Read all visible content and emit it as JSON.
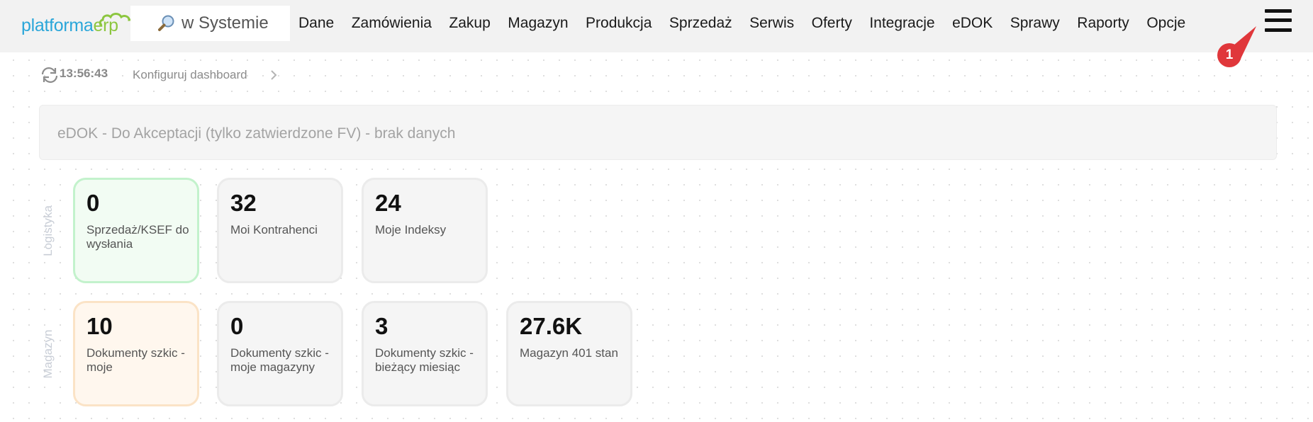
{
  "app": {
    "logo_part1": "platforma",
    "logo_part2": "erp"
  },
  "search": {
    "placeholder": "w Systemie"
  },
  "nav": {
    "items": [
      "Dane",
      "Zamówienia",
      "Zakup",
      "Magazyn",
      "Produkcja",
      "Sprzedaż",
      "Serwis",
      "Oferty",
      "Integracje",
      "eDOK",
      "Sprawy",
      "Raporty",
      "Opcje"
    ]
  },
  "menu": {
    "badge_count": "1"
  },
  "subbar": {
    "time": "13:56:43",
    "config_label": "Konfiguruj dashboard"
  },
  "banner": {
    "text": "eDOK - Do Akceptacji (tylko zatwierdzone FV) - brak danych"
  },
  "rows": [
    {
      "label": "Logistyka",
      "cards": [
        {
          "value": "0",
          "label": "Sprzedaż/KSEF do wysłania",
          "style": "green"
        },
        {
          "value": "32",
          "label": "Moi Kontrahenci",
          "style": "grey"
        },
        {
          "value": "24",
          "label": "Moje Indeksy",
          "style": "grey"
        }
      ]
    },
    {
      "label": "Magazyn",
      "cards": [
        {
          "value": "10",
          "label": "Dokumenty szkic - moje",
          "style": "orange"
        },
        {
          "value": "0",
          "label": "Dokumenty szkic - moje magazyny",
          "style": "grey"
        },
        {
          "value": "3",
          "label": "Dokumenty szkic - bieżący miesiąc",
          "style": "grey"
        },
        {
          "value": "27.6K",
          "label": "Magazyn 401 stan",
          "style": "grey"
        }
      ]
    }
  ],
  "colors": {
    "logo_blue": "#2aa6d9",
    "logo_green": "#8cc63f",
    "badge_red": "#e0373b",
    "card_green_border": "#c3f2cc",
    "card_orange_border": "#fbe3c6"
  },
  "icons": {
    "search": "search-icon",
    "menu": "hamburger-menu-icon",
    "refresh": "refresh-icon",
    "chevron": "chevron-right-icon"
  }
}
